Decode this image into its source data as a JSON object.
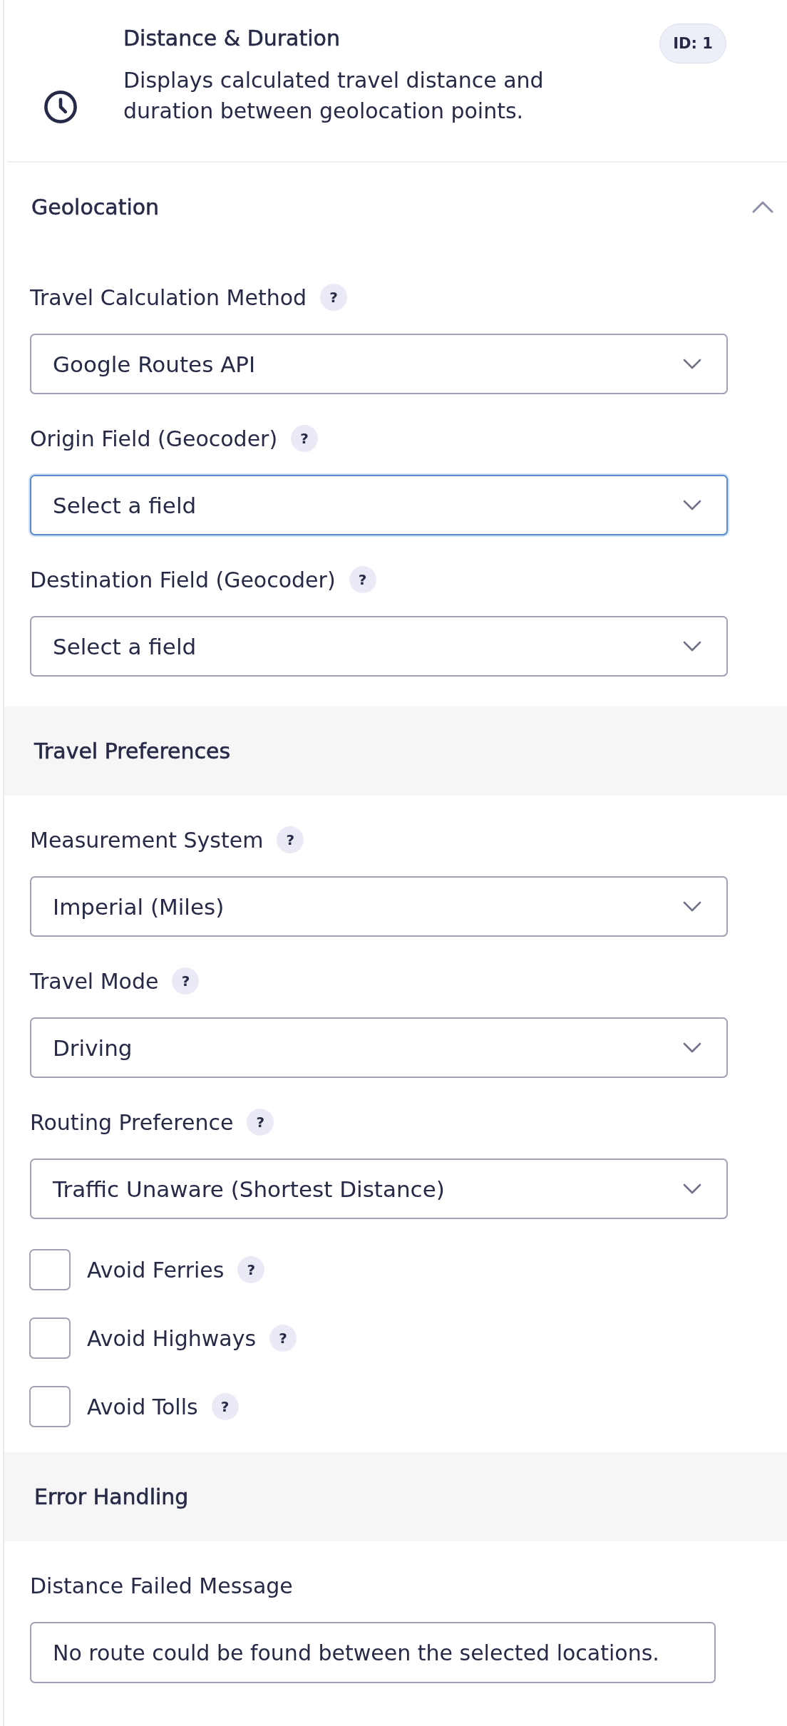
{
  "field_header": {
    "title": "Distance & Duration",
    "description": "Displays calculated travel distance and duration between geolocation points.",
    "id_badge": "ID: 1"
  },
  "panel": {
    "title": "Geolocation",
    "expanded": true,
    "settings": [
      {
        "kind": "select",
        "label": "Travel Calculation Method",
        "help": "?",
        "value": "Google Routes API",
        "focused": false
      },
      {
        "kind": "select",
        "label": "Origin Field (Geocoder)",
        "help": "?",
        "value": "Select a field",
        "focused": true
      },
      {
        "kind": "select",
        "label": "Destination Field (Geocoder)",
        "help": "?",
        "value": "Select a field",
        "focused": false
      },
      {
        "kind": "heading",
        "label": "Travel Preferences"
      },
      {
        "kind": "select",
        "label": "Measurement System",
        "help": "?",
        "value": "Imperial (Miles)",
        "focused": false
      },
      {
        "kind": "select",
        "label": "Travel Mode",
        "help": "?",
        "value": "Driving",
        "focused": false
      },
      {
        "kind": "select",
        "label": "Routing Preference",
        "help": "?",
        "value": "Traffic Unaware (Shortest Distance)",
        "focused": false
      },
      {
        "kind": "checkbox",
        "label": "Avoid Ferries",
        "help": "?",
        "checked": false
      },
      {
        "kind": "checkbox",
        "label": "Avoid Highways",
        "help": "?",
        "checked": false
      },
      {
        "kind": "checkbox",
        "label": "Avoid Tolls",
        "help": "?",
        "checked": false
      },
      {
        "kind": "heading",
        "label": "Error Handling"
      },
      {
        "kind": "text",
        "label": "Distance Failed Message",
        "value": "No route could be found between the selected locations."
      }
    ]
  }
}
